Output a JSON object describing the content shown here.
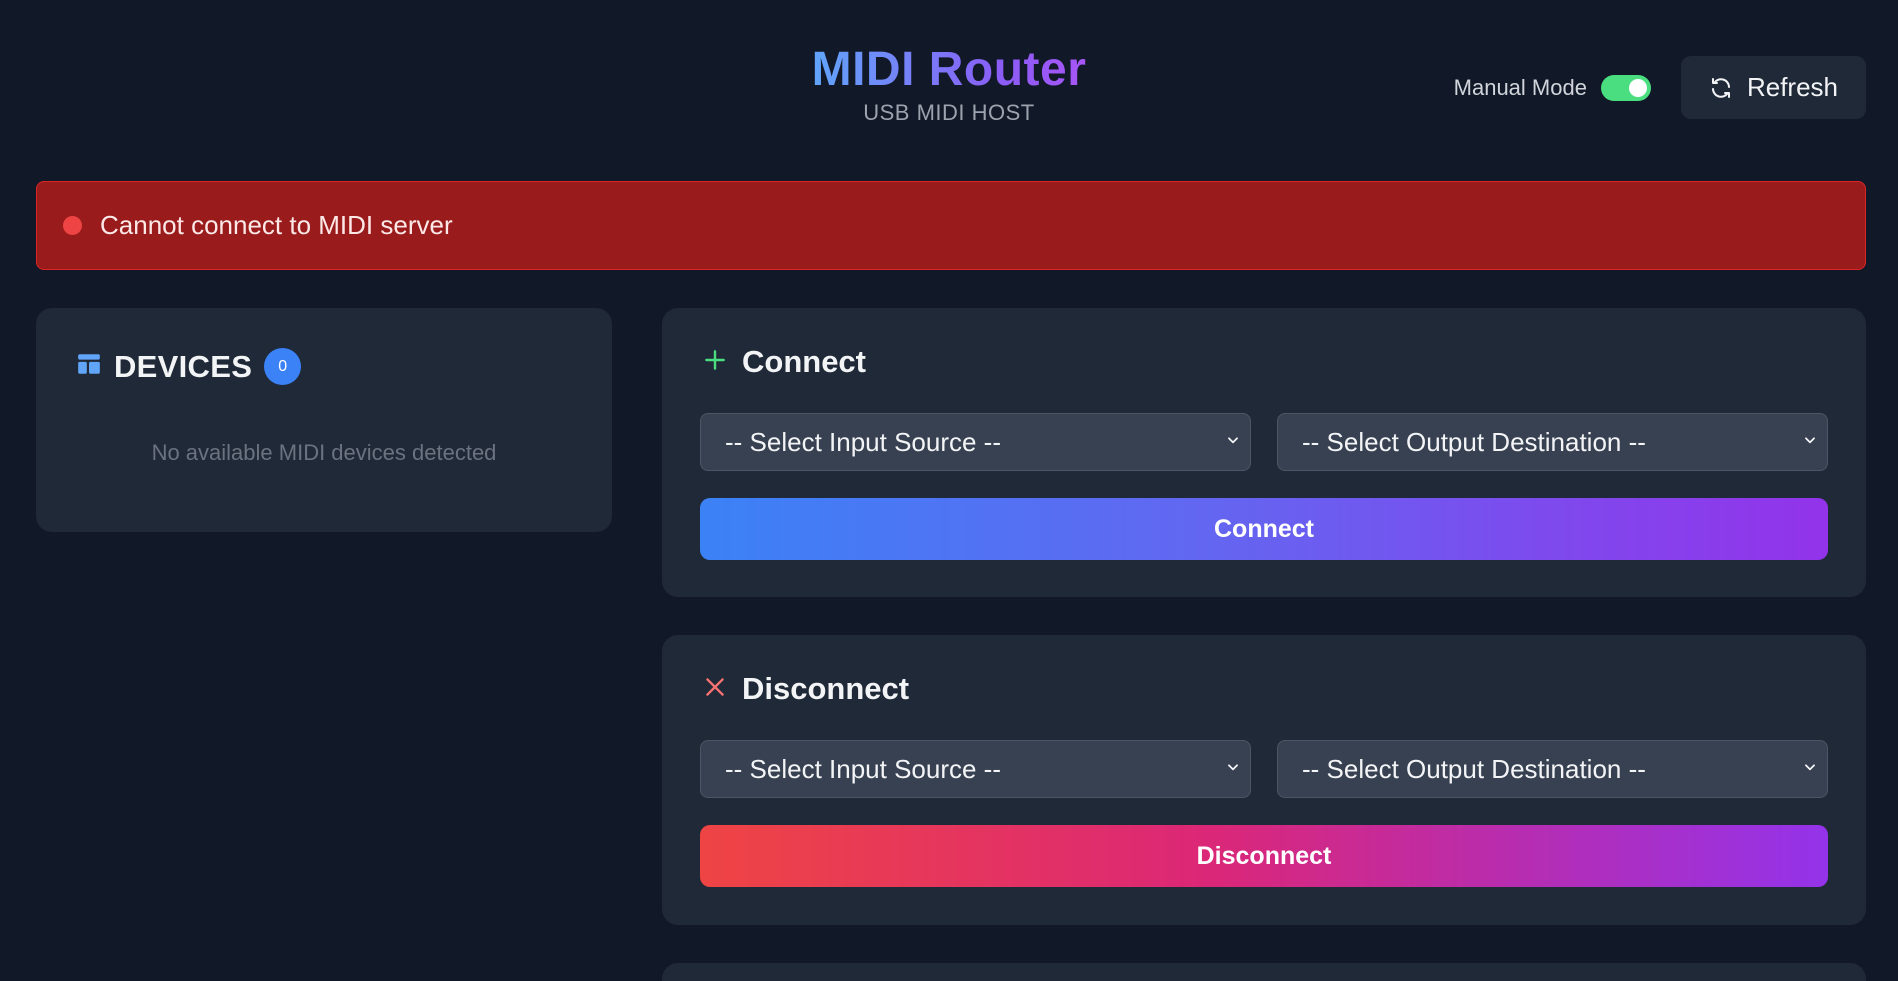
{
  "header": {
    "title": "MIDI Router",
    "subtitle": "USB MIDI HOST",
    "manual_mode_label": "Manual Mode",
    "manual_mode_on": true,
    "refresh_label": "Refresh"
  },
  "error": {
    "message": "Cannot connect to MIDI server"
  },
  "devices": {
    "title": "DEVICES",
    "count": "0",
    "empty_message": "No available MIDI devices detected"
  },
  "connect": {
    "title": "Connect",
    "input_placeholder": "-- Select Input Source --",
    "output_placeholder": "-- Select Output Destination --",
    "button_label": "Connect"
  },
  "disconnect": {
    "title": "Disconnect",
    "input_placeholder": "-- Select Input Source --",
    "output_placeholder": "-- Select Output Destination --",
    "button_label": "Disconnect"
  },
  "colors": {
    "background": "#111827",
    "panel": "#1f2937",
    "error": "#991b1b",
    "toggle_on": "#4ade80",
    "accent_blue": "#3b82f6",
    "accent_purple": "#9333ea",
    "danger": "#ef4444"
  },
  "icons": {
    "refresh": "refresh-icon",
    "devices": "devices-icon",
    "connect": "plus-icon",
    "disconnect": "close-icon",
    "select": "chevron-down-icon"
  }
}
